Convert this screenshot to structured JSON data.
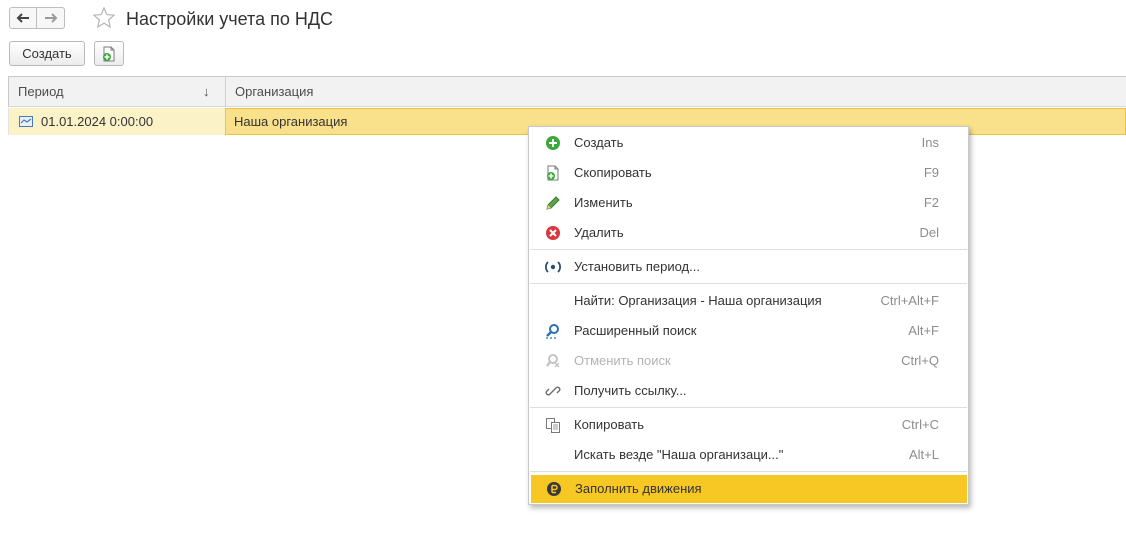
{
  "window": {
    "title": "Настройки учета по НДС"
  },
  "toolbar": {
    "create_label": "Создать"
  },
  "table": {
    "columns": {
      "period": "Период",
      "organization": "Организация"
    },
    "rows": [
      {
        "period": "01.01.2024 0:00:00",
        "organization": "Наша организация"
      }
    ]
  },
  "context_menu": {
    "items": [
      {
        "label": "Создать",
        "shortcut": "Ins",
        "icon": "add-green-icon"
      },
      {
        "label": "Скопировать",
        "shortcut": "F9",
        "icon": "copy-doc-icon"
      },
      {
        "label": "Изменить",
        "shortcut": "F2",
        "icon": "pencil-icon"
      },
      {
        "label": "Удалить",
        "shortcut": "Del",
        "icon": "delete-red-icon"
      },
      {
        "label": "Установить период...",
        "shortcut": "",
        "icon": "period-icon"
      },
      {
        "label": "Найти: Организация - Наша организация",
        "shortcut": "Ctrl+Alt+F",
        "icon": ""
      },
      {
        "label": "Расширенный поиск",
        "shortcut": "Alt+F",
        "icon": "search-icon"
      },
      {
        "label": "Отменить поиск",
        "shortcut": "Ctrl+Q",
        "icon": "cancel-search-icon",
        "disabled": true
      },
      {
        "label": "Получить ссылку...",
        "shortcut": "",
        "icon": "link-icon"
      },
      {
        "label": "Копировать",
        "shortcut": "Ctrl+C",
        "icon": "clipboard-copy-icon"
      },
      {
        "label": "Искать везде \"Наша организаци...\"",
        "shortcut": "Alt+L",
        "icon": ""
      },
      {
        "label": "Заполнить движения",
        "shortcut": "",
        "icon": "fill-movements-icon",
        "highlighted": true
      }
    ]
  },
  "colors": {
    "highlight": "#f7c823",
    "selected_row": "#f9e08a"
  }
}
